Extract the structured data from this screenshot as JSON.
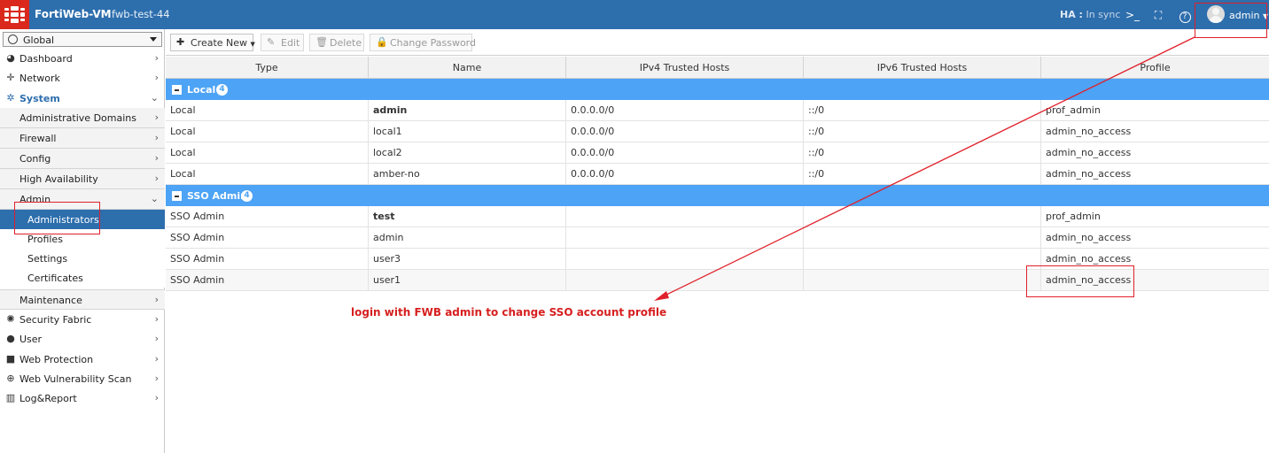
{
  "topbar": {
    "product": "FortiWeb-VM",
    "hostname": "fwb-test-44",
    "ha_label": "HA :",
    "ha_status": "In sync",
    "user": "admin",
    "brand_color": "#da291c",
    "bar_color": "#2d6ead"
  },
  "sidebar": {
    "vdom": "Global",
    "items": [
      {
        "label": "Dashboard",
        "icon": "dashboard-icon"
      },
      {
        "label": "Network",
        "icon": "network-icon"
      },
      {
        "label": "System",
        "icon": "gear-icon"
      },
      {
        "label": "Security Fabric",
        "icon": "fabric-icon"
      },
      {
        "label": "User",
        "icon": "user-icon"
      },
      {
        "label": "Web Protection",
        "icon": "lock-icon"
      },
      {
        "label": "Web Vulnerability Scan",
        "icon": "scan-icon"
      },
      {
        "label": "Log&Report",
        "icon": "chart-icon"
      }
    ],
    "system_subs": [
      {
        "label": "Administrative Domains"
      },
      {
        "label": "Firewall"
      },
      {
        "label": "Config"
      },
      {
        "label": "High Availability"
      },
      {
        "label": "Admin"
      },
      {
        "label": "Maintenance"
      }
    ],
    "admin_leaves": [
      {
        "label": "Administrators"
      },
      {
        "label": "Profiles"
      },
      {
        "label": "Settings"
      },
      {
        "label": "Certificates"
      }
    ]
  },
  "toolbar": {
    "create_new": "Create New",
    "edit": "Edit",
    "delete": "Delete",
    "change_password": "Change Password"
  },
  "table": {
    "columns": [
      "Type",
      "Name",
      "IPv4 Trusted Hosts",
      "IPv6 Trusted Hosts",
      "Profile"
    ],
    "groups": [
      {
        "label": "Local",
        "count": "4",
        "rows": [
          {
            "type": "Local",
            "name": "admin",
            "ipv4": "0.0.0.0/0",
            "ipv6": "::/0",
            "profile": "prof_admin"
          },
          {
            "type": "Local",
            "name": "local1",
            "ipv4": "0.0.0.0/0",
            "ipv6": "::/0",
            "profile": "admin_no_access"
          },
          {
            "type": "Local",
            "name": "local2",
            "ipv4": "0.0.0.0/0",
            "ipv6": "::/0",
            "profile": "admin_no_access"
          },
          {
            "type": "Local",
            "name": "amber-no",
            "ipv4": "0.0.0.0/0",
            "ipv6": "::/0",
            "profile": "admin_no_access"
          }
        ]
      },
      {
        "label": "SSO Admin",
        "count": "4",
        "rows": [
          {
            "type": "SSO Admin",
            "name": "test",
            "ipv4": "",
            "ipv6": "",
            "profile": "prof_admin"
          },
          {
            "type": "SSO Admin",
            "name": "admin",
            "ipv4": "",
            "ipv6": "",
            "profile": "admin_no_access"
          },
          {
            "type": "SSO Admin",
            "name": "user3",
            "ipv4": "",
            "ipv6": "",
            "profile": "admin_no_access"
          },
          {
            "type": "SSO Admin",
            "name": "user1",
            "ipv4": "",
            "ipv6": "",
            "profile": "admin_no_access"
          }
        ]
      }
    ],
    "group_color": "#4da3f5"
  },
  "annotation": {
    "text": "login with FWB admin to change SSO account profile",
    "color": "#d62020"
  }
}
